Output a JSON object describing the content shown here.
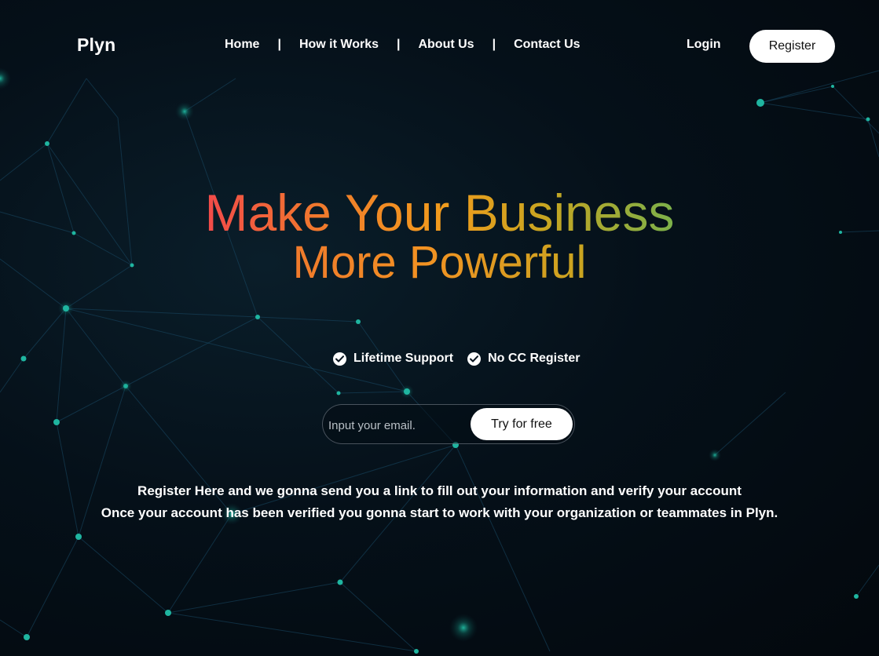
{
  "brand": {
    "logo_text": "Plyn"
  },
  "nav": {
    "links": [
      {
        "label": "Home"
      },
      {
        "label": "How it Works"
      },
      {
        "label": "About Us"
      },
      {
        "label": "Contact Us"
      }
    ],
    "separator": "|",
    "login_label": "Login",
    "register_label": "Register"
  },
  "hero": {
    "headline_line1": "Make Your Business",
    "headline_line2": "More Powerful",
    "features": [
      {
        "label": "Lifetime Support",
        "icon": "check-circle-icon"
      },
      {
        "label": "No CC Register",
        "icon": "check-circle-icon"
      }
    ],
    "email_placeholder": "Input your email.",
    "email_value": "",
    "cta_label": "Try for free",
    "description_line1": "Register Here and we gonna send you a link to fill out your information and verify your account",
    "description_line2": "Once your account has been verified you gonna start to work with your organization or teammates in Plyn."
  },
  "colors": {
    "background": "#040b12",
    "network_line": "#1a4a66",
    "network_node": "#1fb5a0",
    "gradient_red": "#f24a4a",
    "gradient_orange": "#f29b1d",
    "gradient_green": "#7bb04a",
    "button_bg": "#ffffff",
    "button_text": "#111111"
  }
}
